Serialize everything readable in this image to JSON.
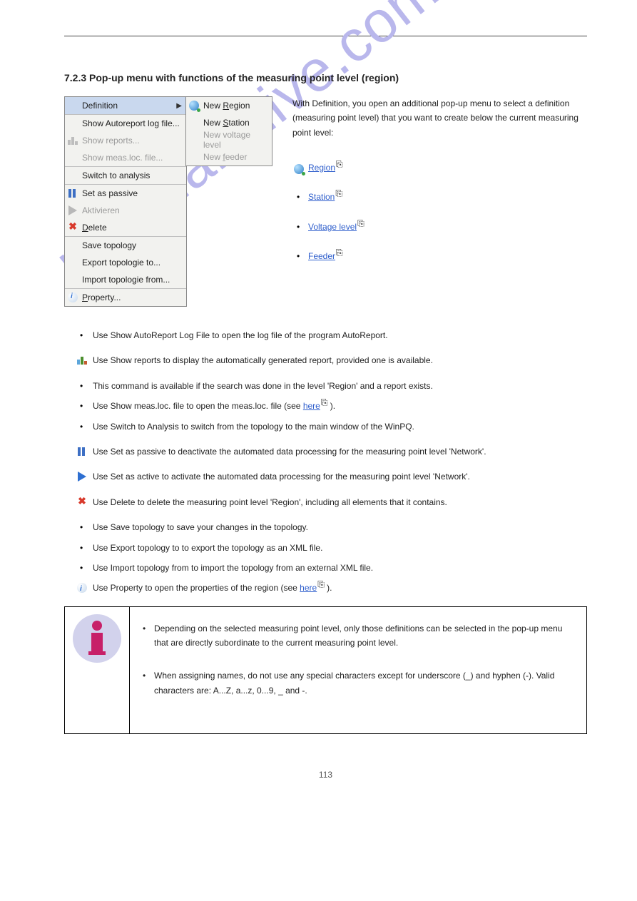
{
  "watermark": "manualshive.com",
  "page_number": "113",
  "section_title": "7.2.3 Pop-up menu with functions of the measuring point level (region)",
  "menu": {
    "definition": "Definition",
    "show_autoreport": "Show Autoreport log file...",
    "show_reports": "Show reports...",
    "show_meas": "Show meas.loc. file...",
    "switch": "Switch to analysis",
    "passive": "Set as passive",
    "activate": "Aktivieren",
    "delete": "Delete",
    "save_topo": "Save topology",
    "export_topo": "Export topologie to...",
    "import_topo": "Import topologie from...",
    "property": "Property..."
  },
  "submenu": {
    "new_region": "New Region",
    "new_station": "New Station",
    "new_voltage": "New voltage level",
    "new_feeder": "New feeder"
  },
  "intro": "With Definition, you open an additional pop-up menu to select a definition (measuring point level) that you want to create below the current measuring point level:",
  "def_items": {
    "region_pre": " ",
    "region_link": "Region",
    "region_post": " (",
    "station_link": "Station",
    "station_post": " (",
    "vl_link": "Voltage level",
    "vl_post": " (",
    "feeder_link": "Feeder",
    "feeder_post": " ("
  },
  "body": {
    "autoreport": "Use Show AutoReport Log File to open the log file of the program AutoReport.",
    "reports": " Use Show reports to display the automatically generated report, provided one is available.",
    "search": "This command is available if the search was done in the level 'Region' and a report exists.",
    "meas_pre": "Use Show meas.loc. file to open the meas.loc. file (see ",
    "meas_link": "here",
    "meas_post": " ).",
    "switch": "Use Switch to Analysis to switch from the topology to the main window of the WinPQ.",
    "passive": " Use Set as passive to deactivate the automated data processing for the measuring point level 'Network'.",
    "activate": " Use Set as active to activate the automated data processing for the measuring point level 'Network'.",
    "delete": " Use Delete to delete the measuring point level 'Region', including all elements that it contains.",
    "save_topo": "Use Save topology to save your changes in the topology.",
    "export_topo": "Use Export topology to to export the topology as an XML file.",
    "import_topo": "Use Import topology from to import the topology from an external XML file.",
    "property_pre": " Use Property to open the properties of the region (see ",
    "property_link": "here",
    "property_post": " ).",
    "note1": "Depending on the selected measuring point level, only those definitions can be selected in the pop-up menu that are directly subordinate to the current measuring point level.",
    "note2": "When assigning names, do not use any special characters except for underscore (_) and hyphen (-). Valid characters are: A...Z, a...z, 0...9, _ and -."
  }
}
